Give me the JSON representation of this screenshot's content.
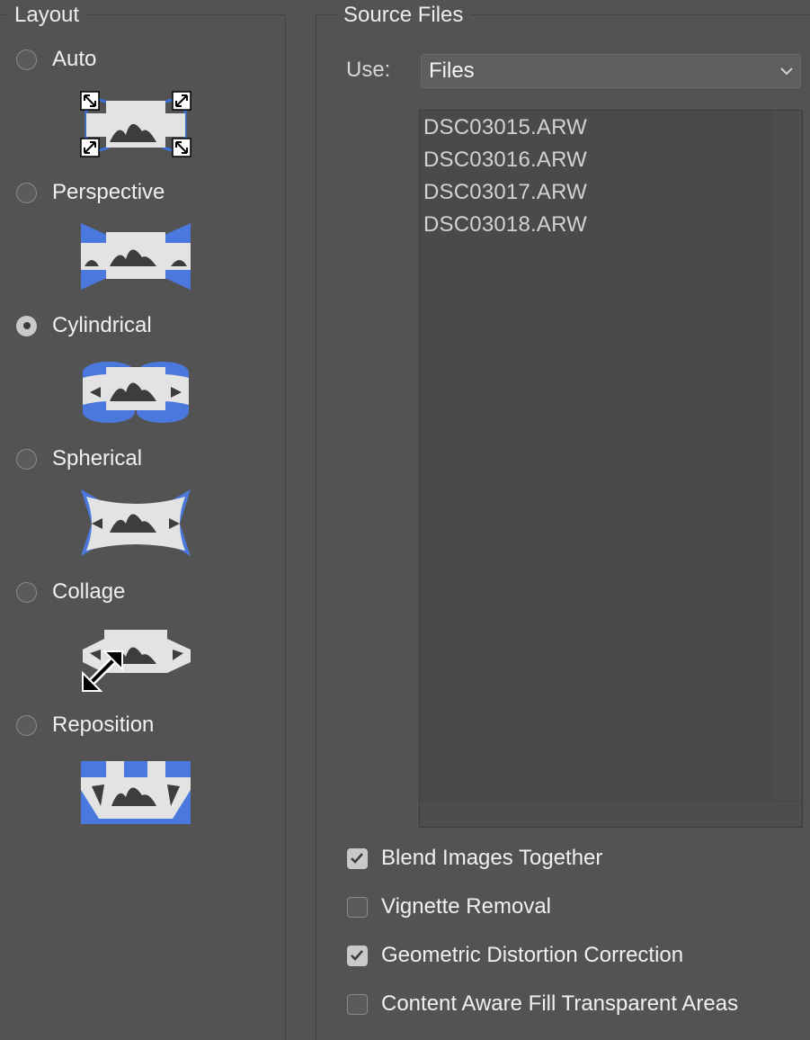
{
  "layout": {
    "legend": "Layout",
    "options": [
      {
        "label": "Auto",
        "checked": false,
        "icon": "auto-layout-icon"
      },
      {
        "label": "Perspective",
        "checked": false,
        "icon": "perspective-layout-icon"
      },
      {
        "label": "Cylindrical",
        "checked": true,
        "icon": "cylindrical-layout-icon"
      },
      {
        "label": "Spherical",
        "checked": false,
        "icon": "spherical-layout-icon"
      },
      {
        "label": "Collage",
        "checked": false,
        "icon": "collage-layout-icon"
      },
      {
        "label": "Reposition",
        "checked": false,
        "icon": "reposition-layout-icon"
      }
    ]
  },
  "source": {
    "legend": "Source Files",
    "use_label": "Use:",
    "use_value": "Files",
    "files": [
      "DSC03015.ARW",
      "DSC03016.ARW",
      "DSC03017.ARW",
      "DSC03018.ARW"
    ]
  },
  "options": {
    "blend": {
      "label": "Blend Images Together",
      "checked": true
    },
    "vignette": {
      "label": "Vignette Removal",
      "checked": false
    },
    "distortion": {
      "label": "Geometric Distortion Correction",
      "checked": true
    },
    "content_aware": {
      "label": "Content Aware Fill Transparent Areas",
      "checked": false
    }
  },
  "colors": {
    "accent": "#4a78dc",
    "panel": "#535353",
    "tile": "#e3e3e3",
    "mountain": "#3d3d3d"
  }
}
